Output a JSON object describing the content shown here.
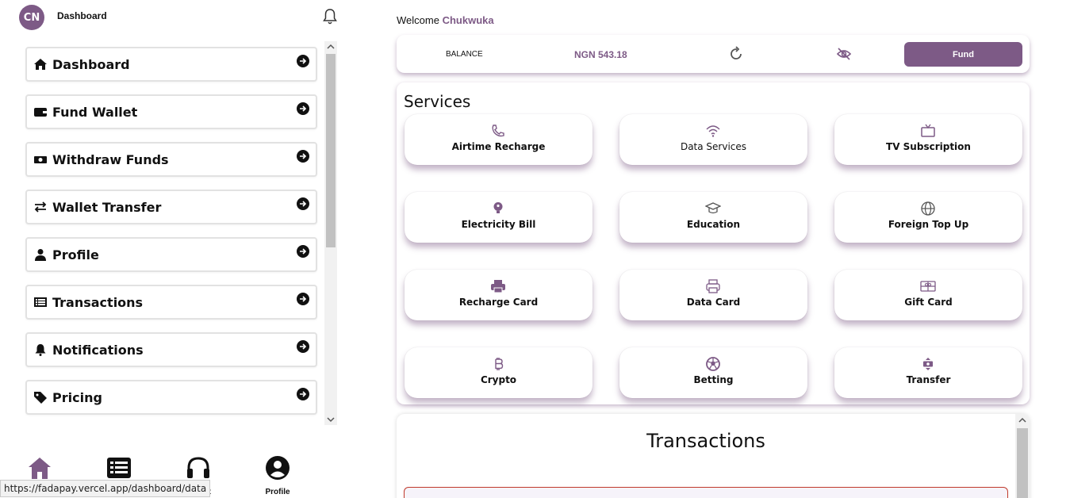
{
  "header": {
    "avatar_initials": "CN",
    "title": "Dashboard"
  },
  "sidebar": {
    "items": [
      {
        "label": "Dashboard",
        "icon": "house-icon"
      },
      {
        "label": "Fund Wallet",
        "icon": "wallet-icon"
      },
      {
        "label": "Withdraw Funds",
        "icon": "money-icon"
      },
      {
        "label": "Wallet Transfer",
        "icon": "transfer-arrows-icon"
      },
      {
        "label": "Profile",
        "icon": "user-icon"
      },
      {
        "label": "Transactions",
        "icon": "list-icon"
      },
      {
        "label": "Notifications",
        "icon": "bell-icon"
      },
      {
        "label": "Pricing",
        "icon": "tag-icon"
      }
    ]
  },
  "bottom_nav": {
    "support_label": "upport",
    "profile_label": "Profile"
  },
  "status_url": "https://fadapay.vercel.app/dashboard/data",
  "main": {
    "welcome_prefix": "Welcome",
    "welcome_name": "Chukwuka",
    "balance_label": "BALANCE",
    "balance_value": "NGN 543.18",
    "fund_label": "Fund",
    "services_title": "Services",
    "services": [
      {
        "label": "Airtime Recharge",
        "icon": "phone-icon"
      },
      {
        "label": "Data Services",
        "icon": "wifi-icon"
      },
      {
        "label": "TV Subscription",
        "icon": "tv-icon"
      },
      {
        "label": "Electricity Bill",
        "icon": "bulb-icon"
      },
      {
        "label": "Education",
        "icon": "graduation-cap-icon"
      },
      {
        "label": "Foreign Top Up",
        "icon": "globe-icon"
      },
      {
        "label": "Recharge Card",
        "icon": "printer-filled-icon"
      },
      {
        "label": "Data Card",
        "icon": "printer-icon"
      },
      {
        "label": "Gift Card",
        "icon": "gift-card-icon"
      },
      {
        "label": "Crypto",
        "icon": "bitcoin-icon"
      },
      {
        "label": "Betting",
        "icon": "football-icon"
      },
      {
        "label": "Transfer",
        "icon": "transfer-icon"
      }
    ],
    "transactions_title": "Transactions"
  },
  "colors": {
    "accent": "#7d5a86"
  }
}
